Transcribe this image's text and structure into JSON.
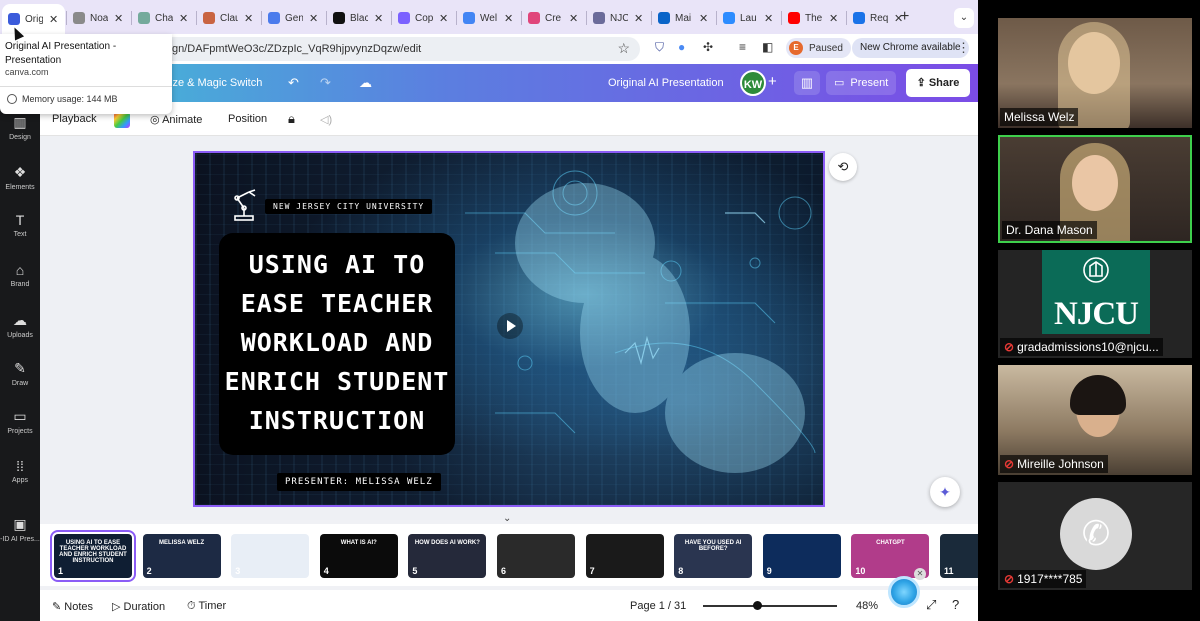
{
  "browser": {
    "tabs": [
      {
        "title": "Orig",
        "active": true,
        "icon": "canva-doc-icon",
        "color": "#3b5bdb"
      },
      {
        "title": "Noa",
        "icon": "chart-icon",
        "color": "#8a8a8a"
      },
      {
        "title": "Cha",
        "icon": "chatgpt-icon",
        "color": "#74aa9c"
      },
      {
        "title": "Clau",
        "icon": "claude-icon",
        "color": "#c96442"
      },
      {
        "title": "Gen",
        "icon": "gemini-icon",
        "color": "#4b7bec"
      },
      {
        "title": "Blac",
        "icon": "blackbox-icon",
        "color": "#111111"
      },
      {
        "title": "Cop",
        "icon": "copilot-icon",
        "color": "#7b61ff"
      },
      {
        "title": "Wel",
        "icon": "docs-icon",
        "color": "#4285f4"
      },
      {
        "title": "Cre",
        "icon": "create-icon",
        "color": "#e0457b"
      },
      {
        "title": "NJC",
        "icon": "njcu-icon",
        "color": "#6b6b9a"
      },
      {
        "title": "Mai",
        "icon": "outlook-icon",
        "color": "#0a64c8"
      },
      {
        "title": "Lau",
        "icon": "zoom-icon",
        "color": "#2d8cff"
      },
      {
        "title": "The",
        "icon": "youtube-icon",
        "color": "#ff0000"
      },
      {
        "title": "Req",
        "icon": "chrome-icon",
        "color": "#1a73e8"
      }
    ],
    "tab_close": "✕",
    "new_tab": "+",
    "url": "gn/DAFpmtWeO3c/ZDzpIc_VqR9hjpvynzDqzw/edit",
    "profile_initial": "E",
    "profile_status": "Paused",
    "update_label": "New Chrome available",
    "tooltip": {
      "title": "Original AI Presentation - Presentation",
      "domain": "canva.com",
      "memory": "Memory usage: 144 MB"
    }
  },
  "canva": {
    "header": {
      "menu_text": "ize & Magic Switch",
      "doc_title": "Original AI Presentation",
      "collaborator_initials": "KW",
      "present_label": "Present",
      "share_label": "Share"
    },
    "sidebar": [
      {
        "label": "Design",
        "icon": "design-icon",
        "glyph": "▥"
      },
      {
        "label": "Elements",
        "icon": "elements-icon",
        "glyph": "❖"
      },
      {
        "label": "Text",
        "icon": "text-icon",
        "glyph": "T"
      },
      {
        "label": "Brand",
        "icon": "brand-icon",
        "glyph": "⌂"
      },
      {
        "label": "Uploads",
        "icon": "uploads-icon",
        "glyph": "☁"
      },
      {
        "label": "Draw",
        "icon": "draw-icon",
        "glyph": "✎"
      },
      {
        "label": "Projects",
        "icon": "folder-icon",
        "glyph": "▭"
      },
      {
        "label": "Apps",
        "icon": "apps-icon",
        "glyph": "⁞⁞"
      },
      {
        "label": "-ID AI Pres...",
        "icon": "project-thumb-icon",
        "glyph": "▣"
      }
    ],
    "toolbar": {
      "playback": "Playback",
      "animate": "Animate",
      "position": "Position"
    },
    "slide": {
      "university": "NEW JERSEY CITY UNIVERSITY",
      "title_lines": [
        "USING AI TO",
        "EASE TEACHER",
        "WORKLOAD AND",
        "ENRICH STUDENT",
        "INSTRUCTION"
      ],
      "presenter": "PRESENTER: MELISSA WELZ"
    },
    "thumbnails": [
      {
        "num": "1",
        "text": "USING AI TO EASE TEACHER WORKLOAD AND ENRICH STUDENT INSTRUCTION",
        "bg": "#0f1e33",
        "selected": true
      },
      {
        "num": "2",
        "text": "MELISSA WELZ",
        "bg": "#1d2a44"
      },
      {
        "num": "3",
        "text": "",
        "bg": "#e8eef6"
      },
      {
        "num": "4",
        "text": "WHAT IS AI?",
        "bg": "#0b0b0b"
      },
      {
        "num": "5",
        "text": "HOW DOES AI WORK?",
        "bg": "#25293a"
      },
      {
        "num": "6",
        "text": "",
        "bg": "#2a2a2a"
      },
      {
        "num": "7",
        "text": "",
        "bg": "#1a1a1a"
      },
      {
        "num": "8",
        "text": "HAVE YOU USED AI BEFORE?",
        "bg": "#2a3550"
      },
      {
        "num": "9",
        "text": "",
        "bg": "#0d2c5c"
      },
      {
        "num": "10",
        "text": "CHATGPT",
        "bg": "#b13c8a"
      },
      {
        "num": "11",
        "text": "",
        "bg": "#1a2a3a"
      }
    ],
    "bottombar": {
      "notes": "Notes",
      "duration": "Duration",
      "timer": "Timer",
      "page": "Page 1 / 31",
      "zoom": "48%",
      "zoom_level_percent": 48
    }
  },
  "zoom": {
    "participants": [
      {
        "name": "Melissa Welz",
        "muted": false
      },
      {
        "name": "Dr. Dana Mason",
        "muted": false,
        "speaking": true
      },
      {
        "name": "gradadmissions10@njcu...",
        "muted": true,
        "logo_text": "NJCU"
      },
      {
        "name": "Mireille Johnson",
        "muted": true
      },
      {
        "name": "1917****785",
        "muted": true,
        "phone": true
      }
    ]
  }
}
